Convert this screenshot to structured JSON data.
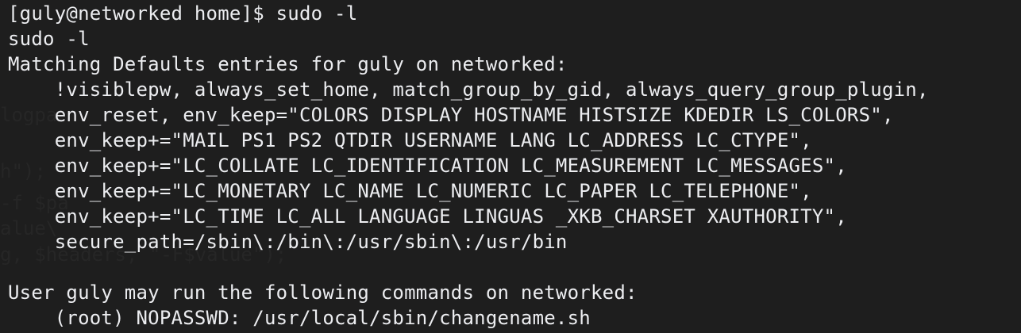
{
  "terminal": {
    "lines": [
      "[guly@networked home]$ sudo -l",
      "sudo -l",
      "Matching Defaults entries for guly on networked:",
      "    !visiblepw, always_set_home, match_group_by_gid, always_query_group_plugin,",
      "    env_reset, env_keep=\"COLORS DISPLAY HOSTNAME HISTSIZE KDEDIR LS_COLORS\",",
      "    env_keep+=\"MAIL PS1 PS2 QTDIR USERNAME LANG LC_ADDRESS LC_CTYPE\",",
      "    env_keep+=\"LC_COLLATE LC_IDENTIFICATION LC_MEASUREMENT LC_MESSAGES\",",
      "    env_keep+=\"LC_MONETARY LC_NAME LC_NUMERIC LC_PAPER LC_TELEPHONE\",",
      "    env_keep+=\"LC_TIME LC_ALL LANGUAGE LINGUAS _XKB_CHARSET XAUTHORITY\",",
      "    secure_path=/sbin\\:/bin\\:/usr/sbin\\:/usr/bin",
      "",
      "User guly may run the following commands on networked:",
      "    (root) NOPASSWD: /usr/local/sbin/changename.sh"
    ],
    "background_ghost_lines": [
      "logpa",
      "h\");",
      "-f $pa",
      "alue\\",
      "g, $headers, \"-F$value\");"
    ]
  },
  "colors": {
    "background": "#1e1e1e",
    "foreground": "#ecedf0",
    "ghost_text": "#262626"
  }
}
